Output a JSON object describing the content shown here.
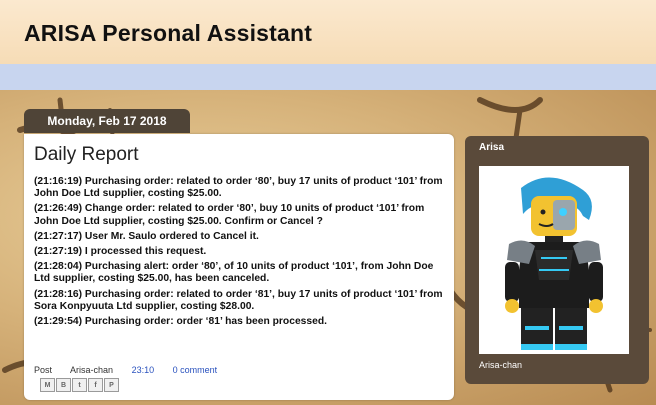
{
  "header": {
    "title": "ARISA Personal Assistant"
  },
  "date_tab": {
    "label": "Monday, Feb 17 2018"
  },
  "post": {
    "title": "Daily Report",
    "entries": [
      "(21:16:19) Purchasing order: related to order ‘80’, buy 17 units of product ‘101’ from John Doe Ltd supplier, costing $25.00.",
      "(21:26:49) Change order: related to order ‘80’, buy 10 units of product ‘101’ from John Doe Ltd supplier, costing $25.00. Confirm or Cancel ?",
      "(21:27:17) User Mr. Saulo ordered to Cancel it.",
      "(21:27:19) I processed this request.",
      "(21:28:04) Purchasing alert: order ‘80’, of 10 units of product ‘101’, from John Doe Ltd supplier, costing $25.00, has been canceled.",
      "(21:28:16) Purchasing order: related to order ‘81’, buy 17 units of product ‘101’ from Sora Konpyuuta Ltd supplier, costing $28.00.",
      "(21:29:54) Purchasing order: order ‘81’ has been processed."
    ],
    "meta": {
      "post_label": "Post",
      "author": "Arisa-chan",
      "time": "23:10",
      "comments": "0 comment"
    },
    "share_icons": [
      "email-icon",
      "blog-icon",
      "twitter-icon",
      "facebook-icon",
      "pinterest-icon"
    ]
  },
  "sidebar": {
    "name": "Arisa",
    "caption": "Arisa-chan",
    "photo_icon": "lego-minifigure-avatar"
  },
  "colors": {
    "header_bg": "#f8e2c2",
    "blue_bar": "#c8d5ef",
    "date_tab": "#4f4437",
    "sidebar_bg": "#5a4a3a",
    "link": "#2a52be"
  }
}
